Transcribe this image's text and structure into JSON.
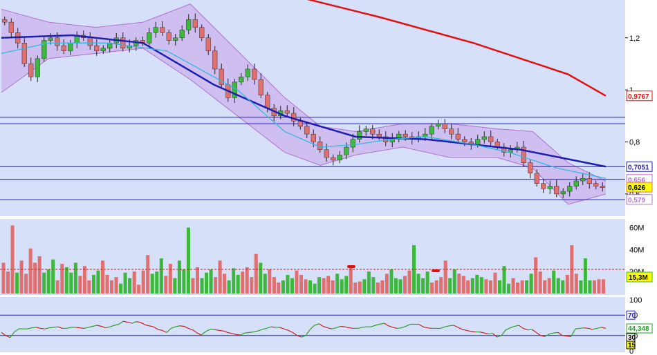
{
  "colors": {
    "panel_bg": "#d6e0f8",
    "outer_bg": "#ffffff",
    "candle_up": "#3cb83c",
    "candle_down": "#e07070",
    "bollinger_fill": "#cdb8ee",
    "bollinger_line": "#b070d0",
    "ma_short": "#30b8e0",
    "ma_mid": "#1e1eb0",
    "ma_long": "#e01010",
    "level_line": "#1a1ad0",
    "rsi_line_up": "#28a028",
    "rsi_line_down": "#c02020",
    "volume_avg": "#d02020"
  },
  "chart_data": [
    {
      "type": "candlestick",
      "panel": "price",
      "ylim": [
        0.52,
        1.34
      ],
      "y_ticks": [
        "1,2",
        "1",
        "0,8",
        "0,6"
      ],
      "horizontal_levels": [
        0.895,
        0.87,
        0.705,
        0.656,
        0.578
      ],
      "moving_averages": [
        {
          "color_key": "ma_long",
          "points": [
            [
              120,
              1.37
            ],
            [
              160,
              1.28
            ],
            [
              200,
              1.18
            ],
            [
              240,
              1.06
            ],
            [
              256,
              0.977
            ]
          ]
        },
        {
          "color_key": "ma_mid",
          "points": [
            [
              0,
              1.2
            ],
            [
              30,
              1.21
            ],
            [
              60,
              1.18
            ],
            [
              90,
              1.02
            ],
            [
              120,
              0.9
            ],
            [
              150,
              0.82
            ],
            [
              180,
              0.81
            ],
            [
              200,
              0.79
            ],
            [
              220,
              0.77
            ],
            [
              256,
              0.705
            ]
          ]
        },
        {
          "color_key": "ma_short",
          "points": [
            [
              0,
              1.14
            ],
            [
              20,
              1.18
            ],
            [
              45,
              1.18
            ],
            [
              70,
              1.15
            ],
            [
              100,
              1.0
            ],
            [
              120,
              0.84
            ],
            [
              135,
              0.78
            ],
            [
              150,
              0.79
            ],
            [
              165,
              0.81
            ],
            [
              180,
              0.82
            ],
            [
              200,
              0.79
            ],
            [
              215,
              0.76
            ],
            [
              235,
              0.7
            ],
            [
              256,
              0.66
            ]
          ]
        }
      ],
      "bollinger": {
        "upper": [
          [
            0,
            1.31
          ],
          [
            20,
            1.26
          ],
          [
            40,
            1.24
          ],
          [
            60,
            1.26
          ],
          [
            80,
            1.33
          ],
          [
            100,
            1.15
          ],
          [
            120,
            0.97
          ],
          [
            135,
            0.86
          ],
          [
            150,
            0.84
          ],
          [
            170,
            0.87
          ],
          [
            190,
            0.87
          ],
          [
            210,
            0.85
          ],
          [
            225,
            0.84
          ],
          [
            240,
            0.72
          ],
          [
            256,
            0.65
          ]
        ],
        "lower": [
          [
            0,
            0.99
          ],
          [
            20,
            1.12
          ],
          [
            40,
            1.14
          ],
          [
            60,
            1.16
          ],
          [
            80,
            1.04
          ],
          [
            100,
            0.9
          ],
          [
            120,
            0.76
          ],
          [
            135,
            0.71
          ],
          [
            150,
            0.75
          ],
          [
            170,
            0.78
          ],
          [
            190,
            0.74
          ],
          [
            210,
            0.74
          ],
          [
            225,
            0.7
          ],
          [
            240,
            0.56
          ],
          [
            256,
            0.6
          ]
        ]
      },
      "price_tags": [
        {
          "text": "0,9767",
          "value": 0.977,
          "color_key": "ma_long"
        },
        {
          "text": "0,7051",
          "value": 0.705,
          "color_key": "ma_mid"
        },
        {
          "text": "0,656",
          "value": 0.656,
          "color_key": "bollinger_line"
        },
        {
          "text": "0,626",
          "value": 0.626,
          "color_key": "candle_down",
          "highlight": true
        },
        {
          "text": "0,579",
          "value": 0.579,
          "color_key": "bollinger_line"
        }
      ],
      "closes": [
        1.26,
        1.22,
        1.18,
        1.1,
        1.05,
        1.12,
        1.19,
        1.2,
        1.17,
        1.15,
        1.18,
        1.21,
        1.2,
        1.17,
        1.15,
        1.16,
        1.18,
        1.2,
        1.16,
        1.17,
        1.19,
        1.18,
        1.22,
        1.24,
        1.22,
        1.19,
        1.2,
        1.23,
        1.27,
        1.24,
        1.2,
        1.15,
        1.08,
        1.02,
        0.97,
        1.03,
        1.05,
        1.08,
        1.04,
        0.98,
        0.93,
        0.9,
        0.92,
        0.91,
        0.88,
        0.86,
        0.83,
        0.8,
        0.77,
        0.74,
        0.73,
        0.75,
        0.78,
        0.81,
        0.84,
        0.85,
        0.83,
        0.82,
        0.8,
        0.81,
        0.83,
        0.82,
        0.81,
        0.82,
        0.83,
        0.86,
        0.87,
        0.85,
        0.83,
        0.81,
        0.8,
        0.79,
        0.81,
        0.82,
        0.8,
        0.78,
        0.76,
        0.77,
        0.78,
        0.72,
        0.68,
        0.64,
        0.62,
        0.63,
        0.6,
        0.61,
        0.63,
        0.65,
        0.66,
        0.64,
        0.63,
        0.626
      ]
    },
    {
      "type": "bar",
      "panel": "volume",
      "ylim": [
        0,
        66
      ],
      "y_ticks": [
        "60M",
        "40M",
        "20M"
      ],
      "current_value_label": "15,3M",
      "moving_average_level": 22,
      "values": [
        28,
        20,
        62,
        19,
        30,
        18,
        41,
        28,
        34,
        19,
        22,
        31,
        12,
        27,
        24,
        19,
        28,
        16,
        25,
        12,
        17,
        21,
        30,
        17,
        12,
        15,
        9,
        19,
        14,
        20,
        8,
        21,
        35,
        18,
        20,
        32,
        16,
        27,
        14,
        30,
        22,
        60,
        14,
        24,
        14,
        19,
        22,
        15,
        30,
        18,
        12,
        23,
        17,
        20,
        24,
        15,
        36,
        28,
        18,
        22,
        15,
        10,
        12,
        17,
        14,
        21,
        17,
        13,
        12,
        9,
        15,
        14,
        16,
        12,
        18,
        13,
        16,
        24,
        10,
        11,
        13,
        20,
        15,
        10,
        12,
        18,
        22,
        14,
        13,
        16,
        21,
        44,
        18,
        14,
        20,
        10,
        12,
        15,
        30,
        14,
        22,
        18,
        16,
        12,
        14,
        17,
        15,
        13,
        12,
        19,
        12,
        25,
        9,
        14,
        10,
        12,
        12,
        18,
        33,
        20,
        12,
        14,
        21,
        14,
        12,
        17,
        44,
        18,
        12,
        32,
        12,
        12,
        13,
        13
      ]
    },
    {
      "type": "line",
      "panel": "rsi",
      "ylim": [
        0,
        100
      ],
      "y_ticks": [
        "100",
        "70",
        "30",
        "0"
      ],
      "levels": [
        70,
        30
      ],
      "current_value_label": "44,348",
      "band_labels": [
        "70",
        "30",
        "15"
      ],
      "values": [
        36,
        30,
        26,
        37,
        43,
        43,
        43,
        45,
        46,
        44,
        43,
        45,
        46,
        47,
        44,
        44,
        46,
        46,
        45,
        44,
        46,
        48,
        50,
        48,
        45,
        47,
        50,
        52,
        58,
        56,
        54,
        57,
        56,
        51,
        49,
        47,
        42,
        40,
        36,
        44,
        47,
        49,
        48,
        44,
        41,
        35,
        31,
        38,
        42,
        42,
        40,
        39,
        36,
        34,
        32,
        31,
        35,
        36,
        37,
        39,
        42,
        44,
        47,
        46,
        46,
        43,
        40,
        36,
        30,
        27,
        30,
        42,
        50,
        53,
        48,
        45,
        43,
        45,
        48,
        47,
        45,
        44,
        44,
        46,
        47,
        47,
        50,
        52,
        54,
        49,
        46,
        44,
        45,
        48,
        52,
        52,
        52,
        47,
        45,
        44,
        44,
        44,
        47,
        49,
        50,
        46,
        42,
        40,
        38,
        37,
        37,
        35,
        33,
        34,
        27,
        30,
        41,
        45,
        48,
        50,
        44,
        41,
        42,
        36,
        30,
        28,
        33,
        35,
        36,
        30,
        29,
        28,
        43,
        44,
        45,
        44,
        42,
        44,
        46,
        44
      ]
    }
  ]
}
